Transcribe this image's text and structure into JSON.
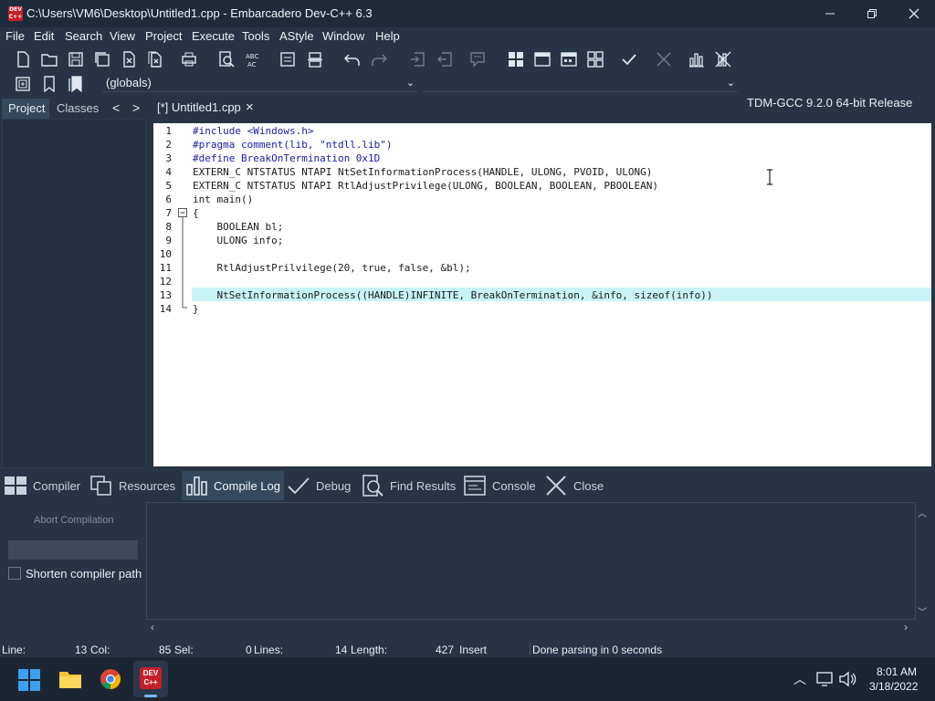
{
  "window": {
    "title": "C:\\Users\\VM6\\Desktop\\Untitled1.cpp - Embarcadero Dev-C++ 6.3",
    "app_icon_text": "DEV C++"
  },
  "menu": [
    "File",
    "Edit",
    "Search",
    "View",
    "Project",
    "Execute",
    "Tools",
    "AStyle",
    "Window",
    "Help"
  ],
  "toolbar": {
    "compiler": "TDM-GCC 9.2.0 64-bit Release",
    "scope_combo": "(globals)"
  },
  "left_panel": {
    "tabs": [
      "Project",
      "Classes"
    ],
    "nav_prev": "<",
    "nav_next": ">"
  },
  "editor": {
    "tab_label": "[*] Untitled1.cpp",
    "tab_close": "×",
    "lines": [
      "#include <Windows.h>",
      "#pragma comment(lib, \"ntdll.lib\")",
      "#define BreakOnTermination 0x1D",
      "EXTERN_C NTSTATUS NTAPI NtSetInformationProcess(HANDLE, ULONG, PVOID, ULONG)",
      "EXTERN_C NTSTATUS NTAPI RtlAdjustPrivilege(ULONG, BOOLEAN, BOOLEAN, PBOOLEAN)",
      "int main()",
      "{",
      "    BOOLEAN bl;",
      "    ULONG info;",
      "",
      "    RtlAdjustPrilvilege(20, true, false, &bl);",
      "",
      "    NtSetInformationProcess((HANDLE)INFINITE, BreakOnTermination, &info, sizeof(info))",
      "}"
    ],
    "line_numbers": [
      "1",
      "2",
      "3",
      "4",
      "5",
      "6",
      "7",
      "8",
      "9",
      "10",
      "11",
      "12",
      "13",
      "14"
    ]
  },
  "bottom_tabs": [
    "Compiler",
    "Resources",
    "Compile Log",
    "Debug",
    "Find Results",
    "Console",
    "Close"
  ],
  "compile_panel": {
    "abort_label": "Abort Compilation",
    "shorten_label": "Shorten compiler path"
  },
  "status": {
    "line_label": "Line:",
    "line_value": "13",
    "col_label": "Col:",
    "col_value": "85",
    "sel_label": "Sel:",
    "sel_value": "0",
    "lines_label": "Lines:",
    "lines_value": "14",
    "length_label": "Length:",
    "length_value": "427",
    "mode": "Insert",
    "message": "Done parsing in 0 seconds"
  },
  "taskbar": {
    "time": "8:01 AM",
    "date": "3/18/2022",
    "devcpp_icon_text": "DEV C++"
  },
  "colors": {
    "background": "#263445",
    "editor_bg": "#ffffff",
    "current_line": "#c9f4f6",
    "keyword": "#1a1aa6",
    "taskbar": "#1c2633"
  }
}
